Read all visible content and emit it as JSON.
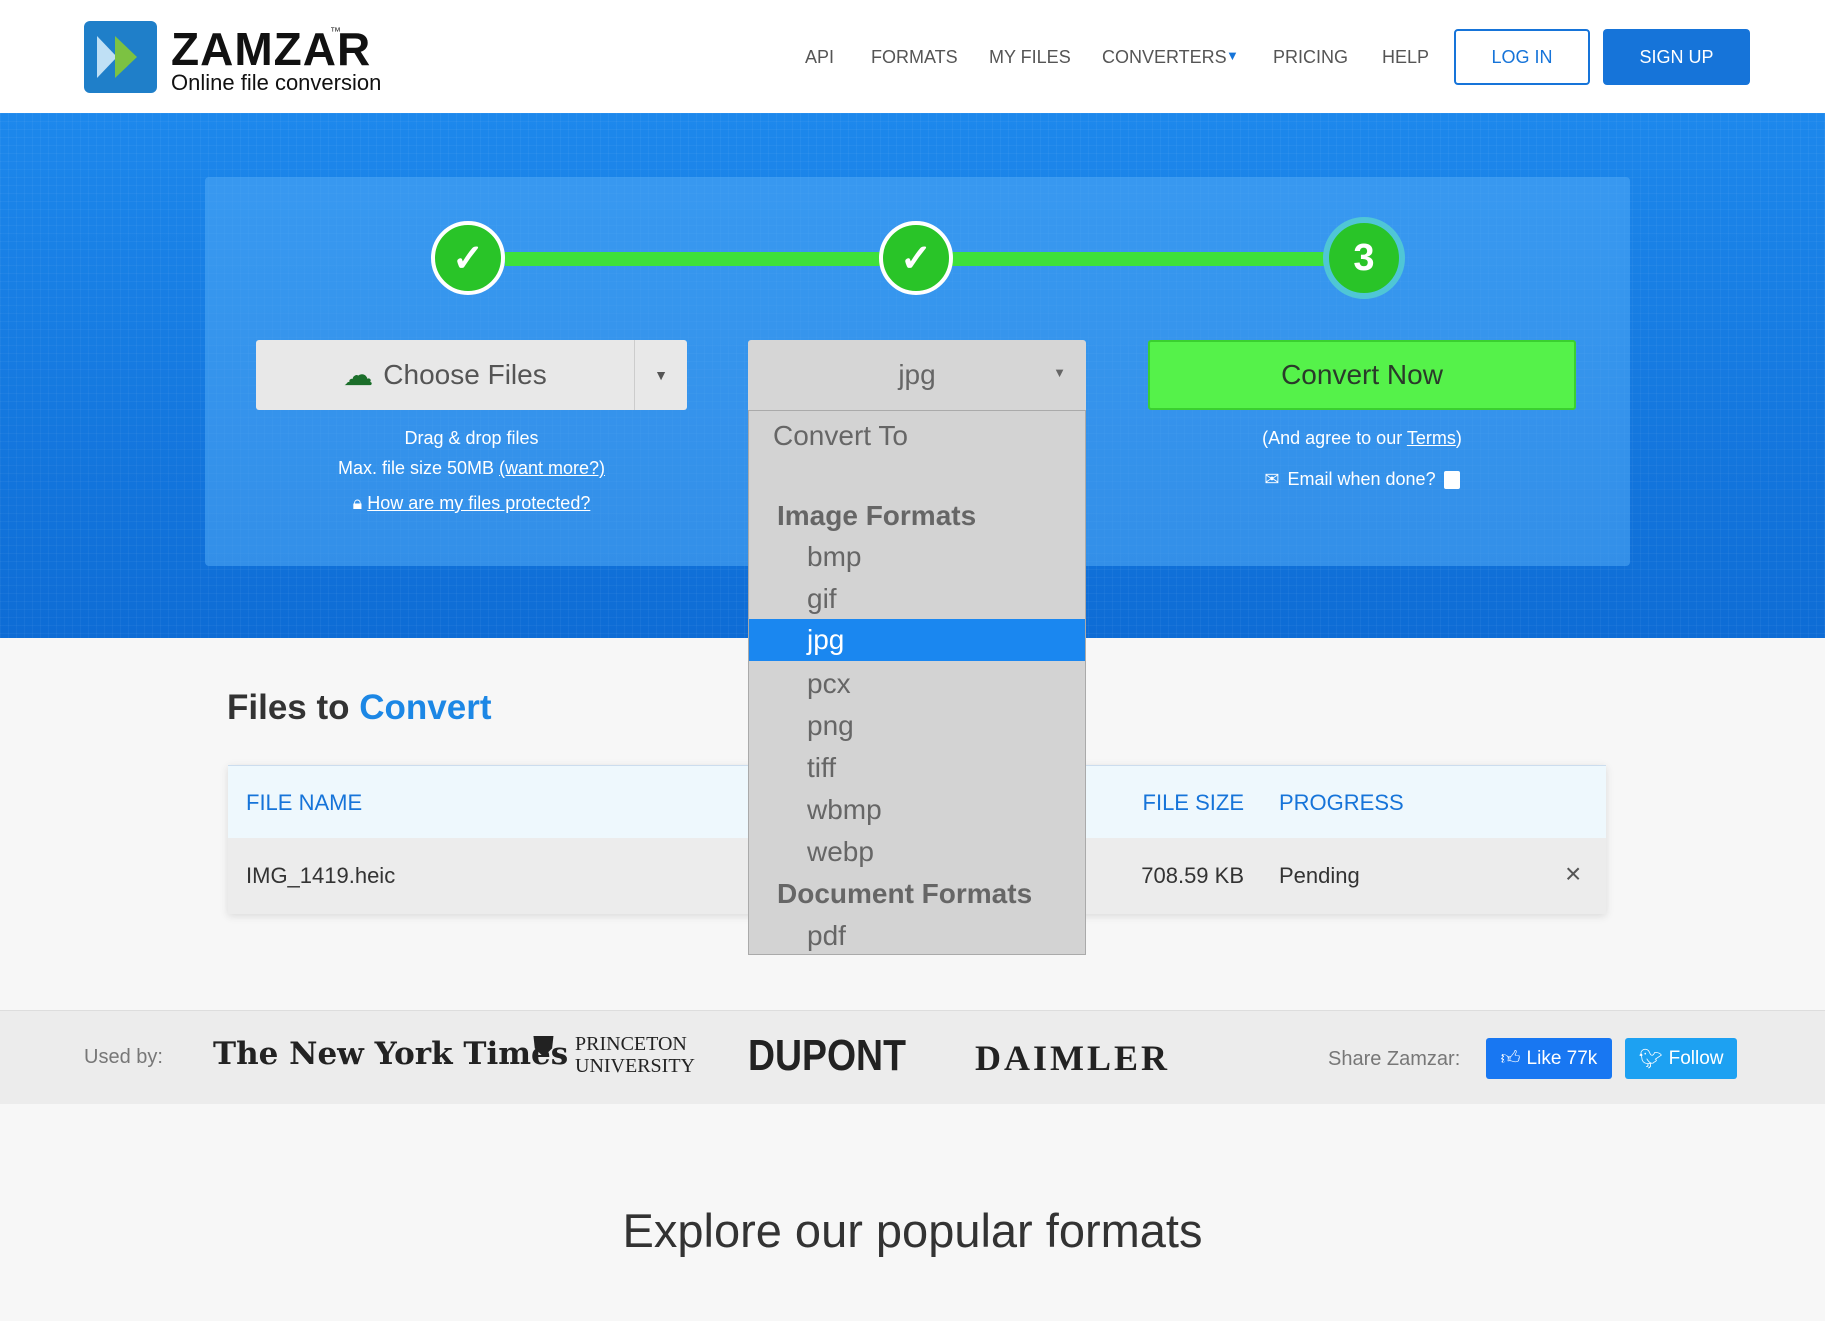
{
  "header": {
    "brand": "ZAMZAR",
    "tm": "™",
    "tagline": "Online file conversion",
    "nav": [
      "API",
      "FORMATS",
      "MY FILES",
      "CONVERTERS",
      "PRICING",
      "HELP"
    ],
    "login": "LOG IN",
    "signup": "SIGN UP"
  },
  "steps": {
    "step3": "3"
  },
  "upload": {
    "choose": "Choose Files",
    "drag": "Drag & drop files",
    "max": "Max. file size 50MB ",
    "want_more": "(want more?)",
    "protected": "How are my files protected?"
  },
  "format": {
    "selected": "jpg",
    "options_title": "Convert To",
    "groups": [
      {
        "label": "Image Formats",
        "items": [
          "bmp",
          "gif",
          "jpg",
          "pcx",
          "png",
          "tiff",
          "wbmp",
          "webp"
        ]
      },
      {
        "label": "Document Formats",
        "items": [
          "pdf"
        ]
      }
    ]
  },
  "convert": {
    "button": "Convert Now",
    "agree_pre": "(And agree to our ",
    "terms": "Terms",
    "agree_post": ")",
    "email": "Email when done?"
  },
  "files": {
    "title_a": "Files to ",
    "title_b": "Convert",
    "columns": [
      "FILE NAME",
      "FILE SIZE",
      "PROGRESS"
    ],
    "rows": [
      {
        "name": "IMG_1419.heic",
        "size": "708.59 KB",
        "progress": "Pending"
      }
    ]
  },
  "usedby": {
    "label": "Used by:",
    "logos": [
      "The New York Times",
      "PRINCETON",
      "UNIVERSITY",
      "DUPONT",
      "DAIMLER"
    ],
    "share": "Share Zamzar:",
    "like": "Like 77k",
    "follow": "Follow"
  },
  "explore": "Explore our popular formats",
  "colors": {
    "accent": "#1674d9",
    "green": "#55f24a",
    "hero": "#1b86ea"
  }
}
